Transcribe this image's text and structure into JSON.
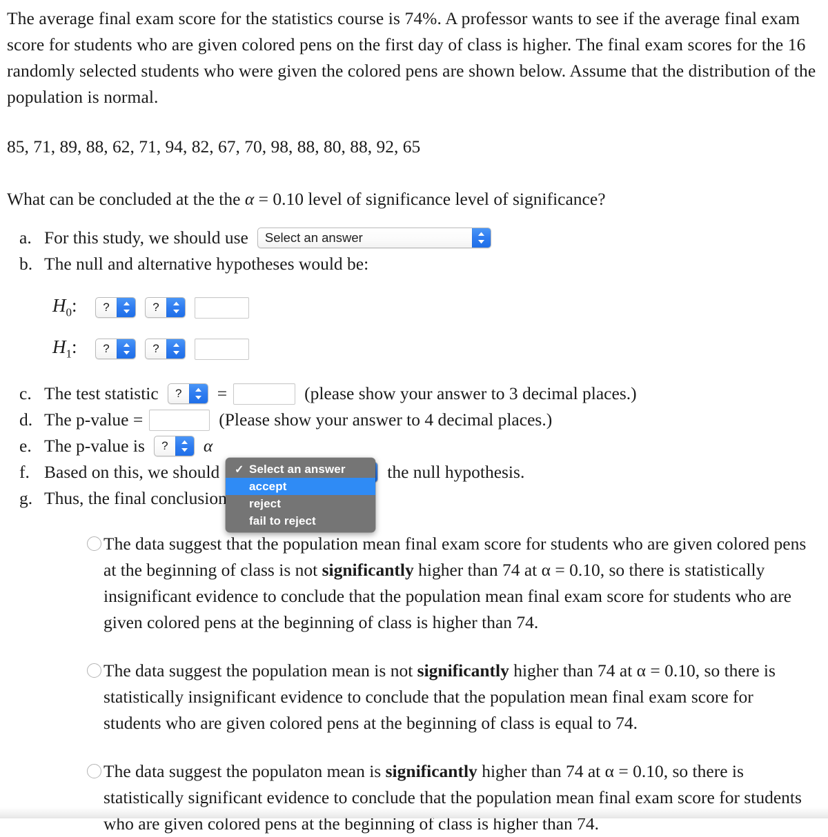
{
  "problem": {
    "intro": "The average final exam score for the statistics course is 74%. A professor wants to see if the average final exam score for students who are given colored pens on the first day of class is higher. The final exam scores for the 16 randomly selected students who were given the colored pens are shown below. Assume that the distribution of the population is normal.",
    "data_values": "85, 71, 89, 88, 62, 71, 94, 82, 67, 70, 98, 88, 80, 88, 92, 65",
    "question_prefix": "What can be concluded at the the ",
    "question_alpha": "α",
    "question_suffix": " = 0.10 level of significance level of significance?"
  },
  "steps": {
    "a": {
      "marker": "a.",
      "text": "For this study, we should use",
      "select_value": "Select an answer"
    },
    "b": {
      "marker": "b.",
      "text": "The null and alternative hypotheses would be:",
      "h0_label": "H",
      "h0_sub": "0",
      "h1_label": "H",
      "h1_sub": "1",
      "colon": ":",
      "select_value": "?",
      "input_value": ""
    },
    "c": {
      "marker": "c.",
      "text": "The test statistic",
      "select_value": "?",
      "equals": "=",
      "input_value": "",
      "hint": "(please show your answer to 3 decimal places.)"
    },
    "d": {
      "marker": "d.",
      "text": "The p-value =",
      "input_value": "",
      "hint": "(Please show your answer to 4 decimal places.)"
    },
    "e": {
      "marker": "e.",
      "text": "The p-value is",
      "select_value": "?",
      "alpha": "α"
    },
    "f": {
      "marker": "f.",
      "text_before": "Based on this, we should",
      "text_after": "the null hypothesis."
    },
    "g": {
      "marker": "g.",
      "text": "Thus, the final conclusion is that ..."
    }
  },
  "open_dropdown": {
    "checkmark": "✓",
    "items": [
      {
        "label": "Select an answer",
        "checked": true,
        "highlighted": false
      },
      {
        "label": "accept",
        "checked": false,
        "highlighted": true
      },
      {
        "label": "reject",
        "checked": false,
        "highlighted": false
      },
      {
        "label": "fail to reject",
        "checked": false,
        "highlighted": false
      }
    ]
  },
  "conclusion_options": [
    {
      "part1": "The data suggest that the population mean final exam score for students who are given colored pens at the beginning of class is not ",
      "bold": "significantly",
      "part2": " higher than 74 at α = 0.10, so there is statistically insignificant evidence to conclude that the population mean final exam score for students who are given colored pens at the beginning of class is higher than 74."
    },
    {
      "part1": "The data suggest the population mean is not ",
      "bold": "significantly",
      "part2": " higher than 74 at α = 0.10, so there is statistically insignificant evidence to conclude that the population mean final exam score for students who are given colored pens at the beginning of class is equal to 74."
    },
    {
      "part1": "The data suggest the populaton mean is ",
      "bold": "significantly",
      "part2": " higher than 74 at α = 0.10, so there is statistically significant evidence to conclude that the population mean final exam score for students who are given colored pens at the beginning of class is higher than 74."
    }
  ],
  "colors": {
    "select_arrow_blue": "#2f7cf0",
    "popup_background": "#757575",
    "popup_highlight": "#2f8bf5",
    "text": "#1b1b1b"
  }
}
